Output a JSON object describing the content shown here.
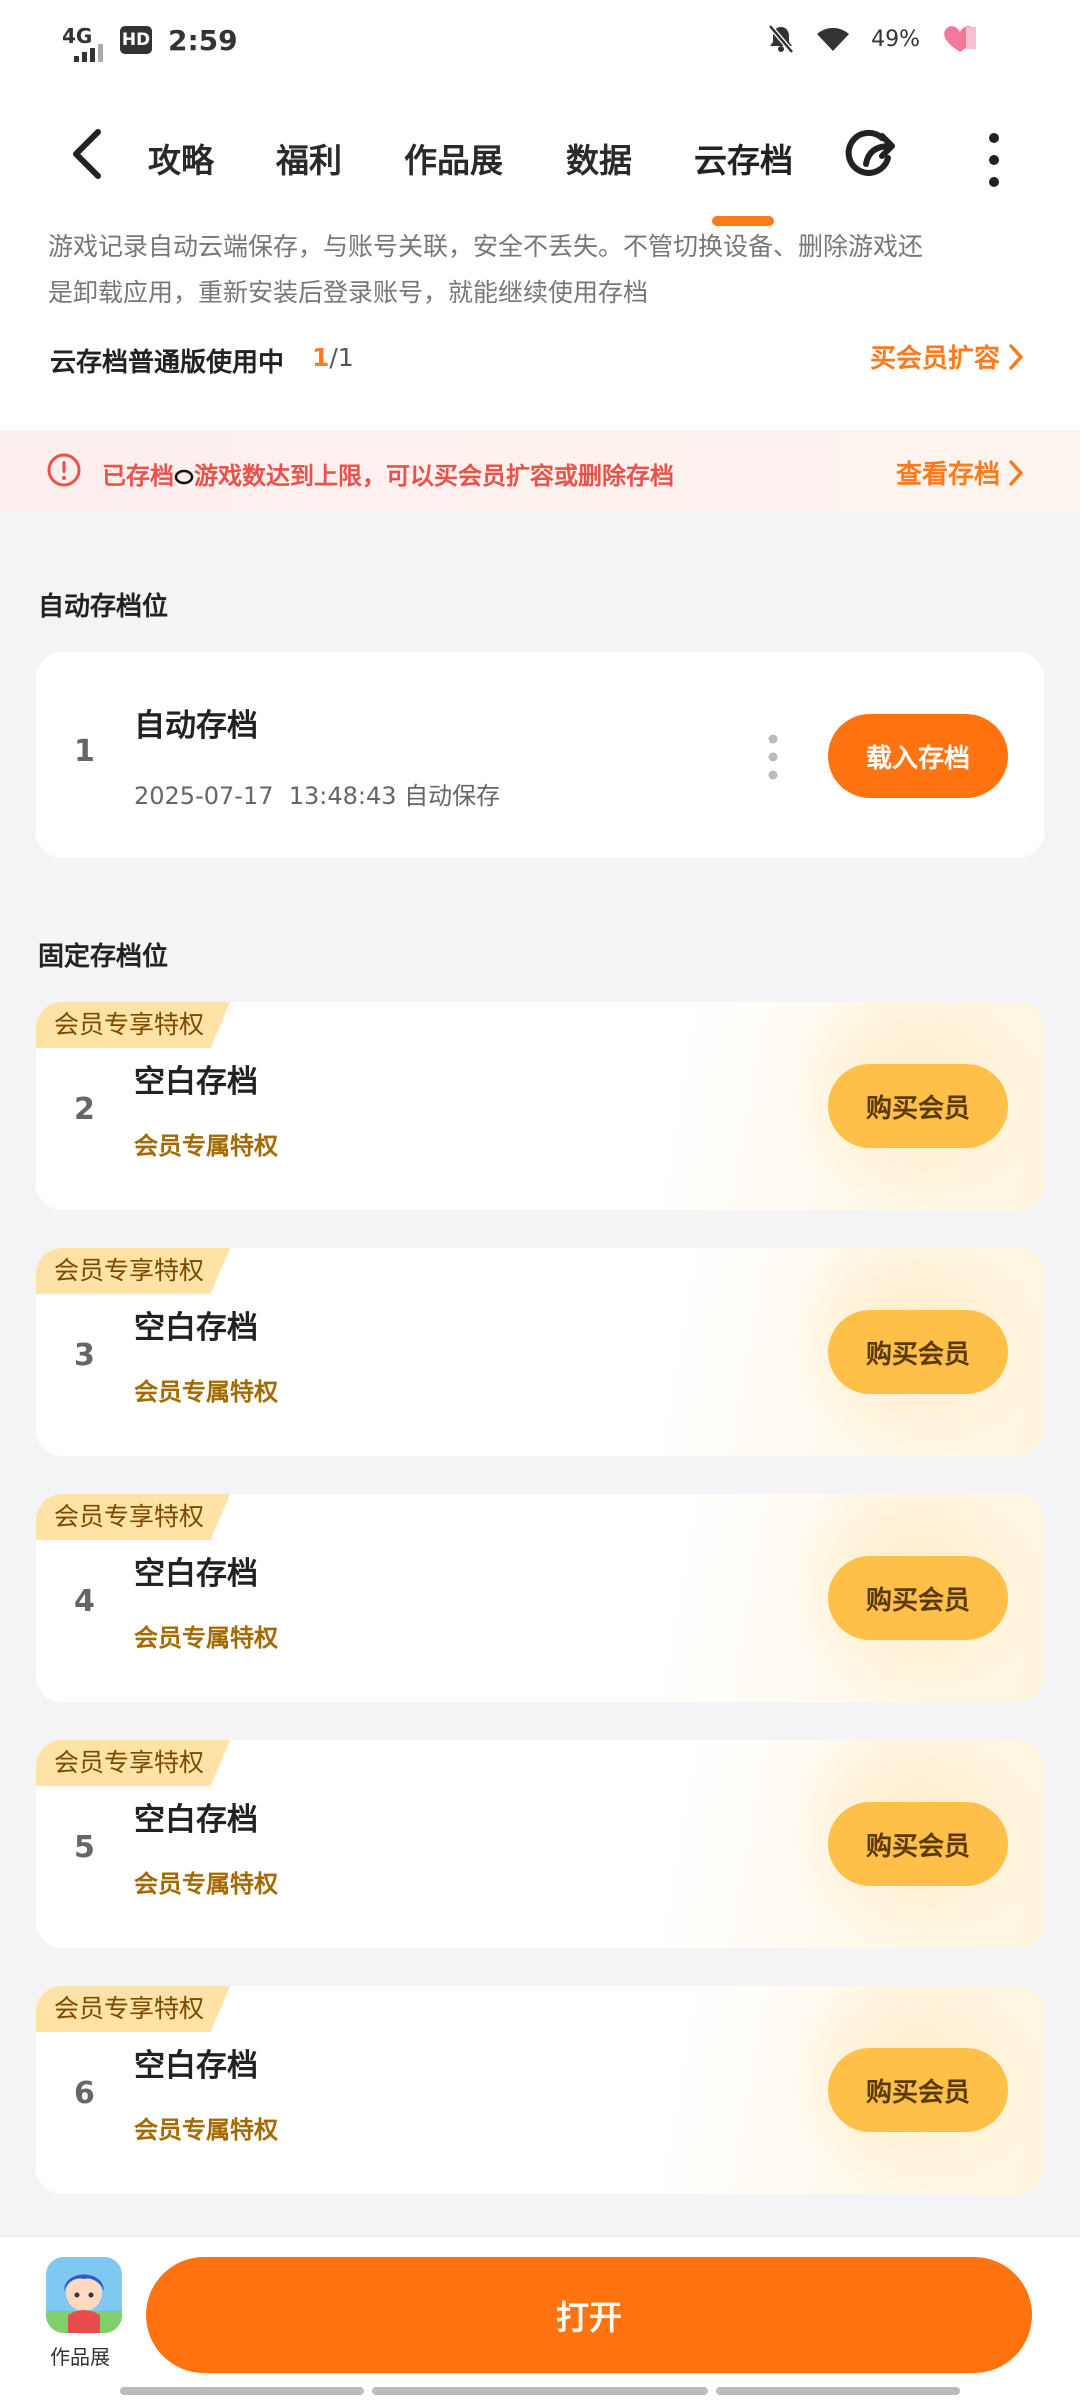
{
  "status_bar": {
    "network": "4G",
    "hd": "HD",
    "time": "2:59",
    "battery": "49%"
  },
  "nav": {
    "tabs": [
      {
        "label": "攻略"
      },
      {
        "label": "福利"
      },
      {
        "label": "作品展"
      },
      {
        "label": "数据"
      },
      {
        "label": "云存档"
      }
    ],
    "active_tab": "云存档"
  },
  "intro": {
    "line1": "游戏记录自动云端保存，与账号关联，安全不丢失。不管切换设备、删除游戏还",
    "line2": "是卸载应用，重新安装后登录账号，就能继续使用存档",
    "usage_label": "云存档普通版使用中",
    "usage_used": "1",
    "usage_total": "/1",
    "upgrade_label": "买会员扩容"
  },
  "warning": {
    "text_before": "已存档",
    "text_after": "游戏数达到上限，可以买会员扩容或删除存档",
    "link_label": "查看存档"
  },
  "auto_section": {
    "title": "自动存档位",
    "slot": {
      "index": "1",
      "title": "自动存档",
      "timestamp": "2025-07-17  13:48:43",
      "mode": "自动保存",
      "button": "载入存档"
    }
  },
  "fixed_section": {
    "title": "固定存档位",
    "slots": [
      {
        "badge": "会员专享特权",
        "index": "2",
        "title": "空白存档",
        "sub": "会员专属特权",
        "button": "购买会员"
      },
      {
        "badge": "会员专享特权",
        "index": "3",
        "title": "空白存档",
        "sub": "会员专属特权",
        "button": "购买会员"
      },
      {
        "badge": "会员专享特权",
        "index": "4",
        "title": "空白存档",
        "sub": "会员专属特权",
        "button": "购买会员"
      },
      {
        "badge": "会员专享特权",
        "index": "5",
        "title": "空白存档",
        "sub": "会员专属特权",
        "button": "购买会员"
      },
      {
        "badge": "会员专享特权",
        "index": "6",
        "title": "空白存档",
        "sub": "会员专属特权",
        "button": "购买会员"
      }
    ]
  },
  "bottom": {
    "app_label": "作品展",
    "open_label": "打开"
  },
  "colors": {
    "accent": "#ff7311",
    "gold": "#ffc04a",
    "warning": "#e8524a",
    "badge": "#ffe2a6"
  }
}
